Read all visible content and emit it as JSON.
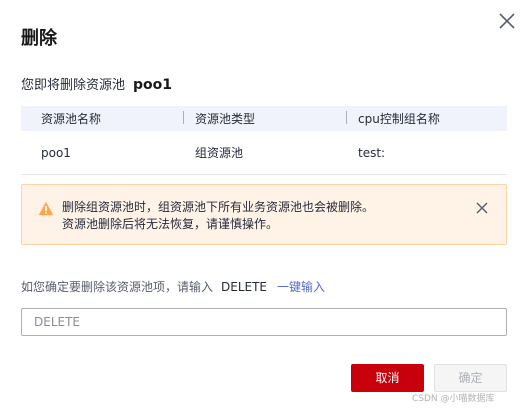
{
  "dialog": {
    "title": "删除",
    "subtitle_prefix": "您即将删除资源池",
    "pool_name": "poo1"
  },
  "table": {
    "headers": [
      "资源池名称",
      "资源池类型",
      "cpu控制组名称"
    ],
    "rows": [
      [
        "poo1",
        "组资源池",
        "test:"
      ]
    ]
  },
  "alert": {
    "line1": "删除组资源池时，组资源池下所有业务资源池也会被删除。",
    "line2": "资源池删除后将无法恢复，请谨慎操作。",
    "color": "#ffa64d"
  },
  "confirm": {
    "prompt": "如您确定要删除该资源池项，请输入",
    "keyword": "DELETE",
    "quick_fill": "一键输入",
    "placeholder": "DELETE"
  },
  "buttons": {
    "cancel": "取消",
    "ok": "确定"
  },
  "watermark": "CSDN @小喵数据库",
  "colors": {
    "primary": "#c7000b",
    "link": "#526ecc"
  }
}
